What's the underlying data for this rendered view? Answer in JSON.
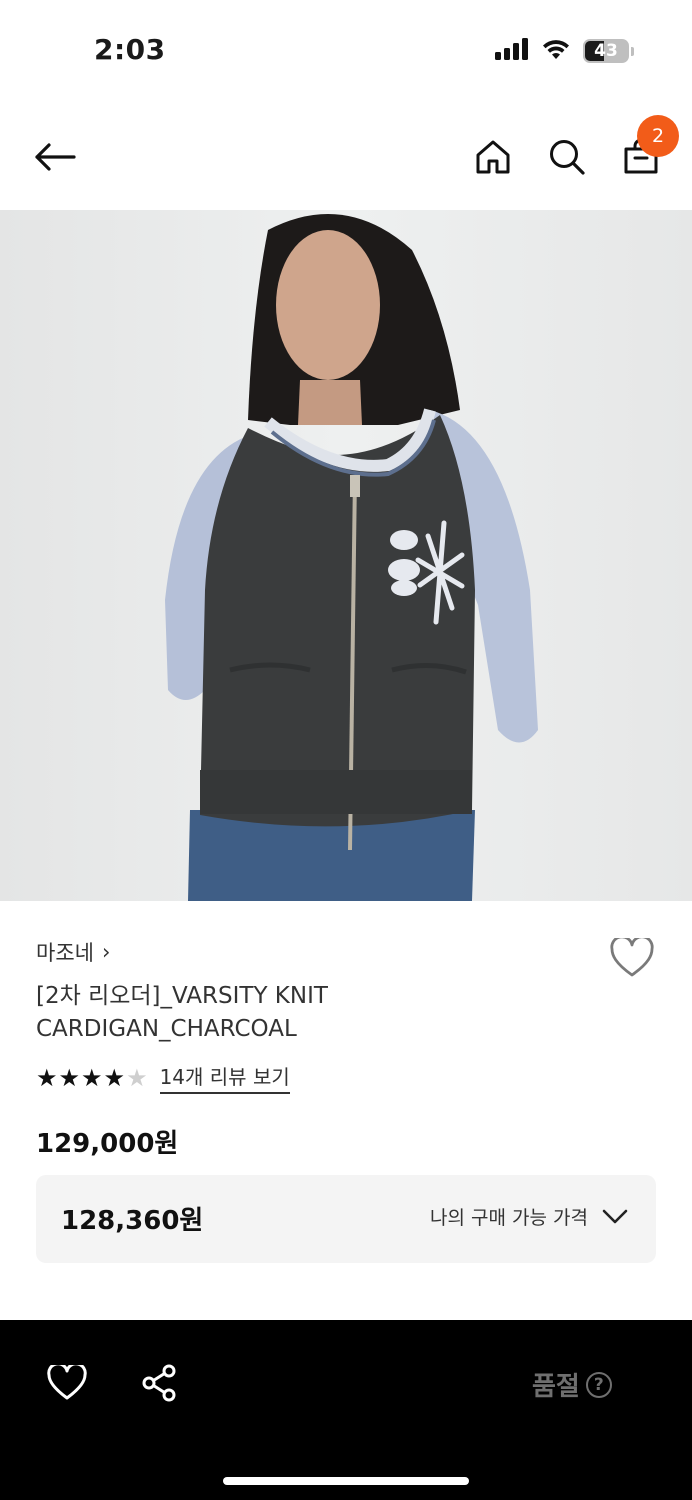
{
  "status_bar": {
    "time": "2:03",
    "battery": "43",
    "icons": [
      "cellular-signal-icon",
      "wifi-icon",
      "battery-icon"
    ]
  },
  "header": {
    "icons": [
      "back-arrow-icon",
      "home-icon",
      "search-icon",
      "shopping-bag-icon"
    ],
    "cart_count": "2",
    "badge_color": "#f25c19"
  },
  "product": {
    "brand": "마조네",
    "brand_chevron": "›",
    "title": "[2차 리오더]_VARSITY KNIT CARDIGAN_CHARCOAL",
    "rating": 4,
    "rating_max": 5,
    "review_link": "14개 리뷰 보기",
    "price": "129,000원",
    "my_price": "128,360원",
    "my_price_label": "나의 구매 가능 가격"
  },
  "bottom_bar": {
    "status_label": "품절",
    "help_symbol": "?",
    "icons": [
      "heart-icon",
      "share-icon",
      "help-icon"
    ]
  }
}
